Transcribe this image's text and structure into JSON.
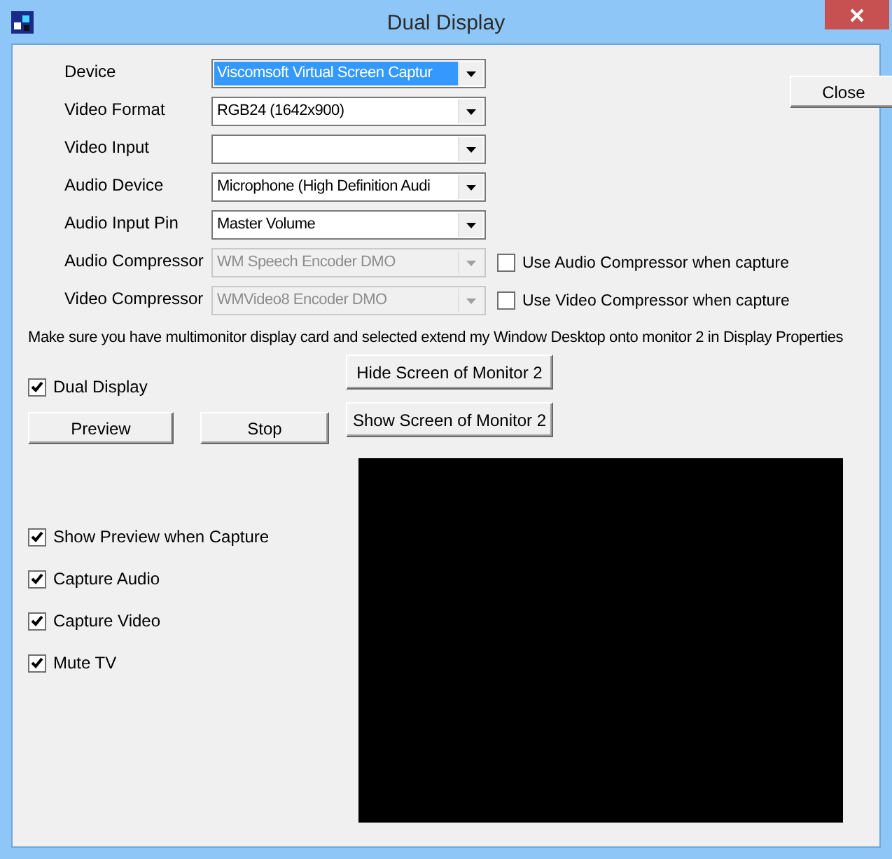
{
  "window": {
    "title": "Dual Display"
  },
  "close_button": "Close",
  "fields": [
    {
      "label": "Device",
      "value": "Viscomsoft Virtual Screen Captur",
      "highlighted": true,
      "disabled": false
    },
    {
      "label": "Video Format",
      "value": "RGB24 (1642x900)",
      "highlighted": false,
      "disabled": false
    },
    {
      "label": "Video Input",
      "highlighted": false,
      "disabled": false
    },
    {
      "label": "Audio Device",
      "value": "Microphone (High Definition Audi",
      "highlighted": false,
      "disabled": false
    },
    {
      "label": "Audio Input Pin",
      "value": "Master Volume",
      "highlighted": false,
      "disabled": false
    },
    {
      "label": "Audio Compressor",
      "value": "WM Speech Encoder DMO",
      "highlighted": false,
      "disabled": true,
      "option": {
        "label": "Use Audio Compressor when capture",
        "checked": false
      }
    },
    {
      "label": "Video Compressor",
      "value": "WMVideo8 Encoder DMO",
      "highlighted": false,
      "disabled": true,
      "option": {
        "label": "Use Video Compressor when capture",
        "checked": false
      }
    }
  ],
  "note": "Make sure you have multimonitor display card and selected extend my Window Desktop onto monitor 2 in Display Properties",
  "dual_display": {
    "label": "Dual Display",
    "checked": true
  },
  "buttons": [
    "Preview",
    "Stop"
  ],
  "monitor_buttons": [
    "Hide Screen of Monitor 2",
    "Show Screen of Monitor 2"
  ],
  "options": [
    {
      "label": "Show Preview when Capture",
      "checked": true
    },
    {
      "label": "Capture Audio",
      "checked": true
    },
    {
      "label": "Capture Video",
      "checked": true
    },
    {
      "label": "Mute TV",
      "checked": true
    }
  ]
}
